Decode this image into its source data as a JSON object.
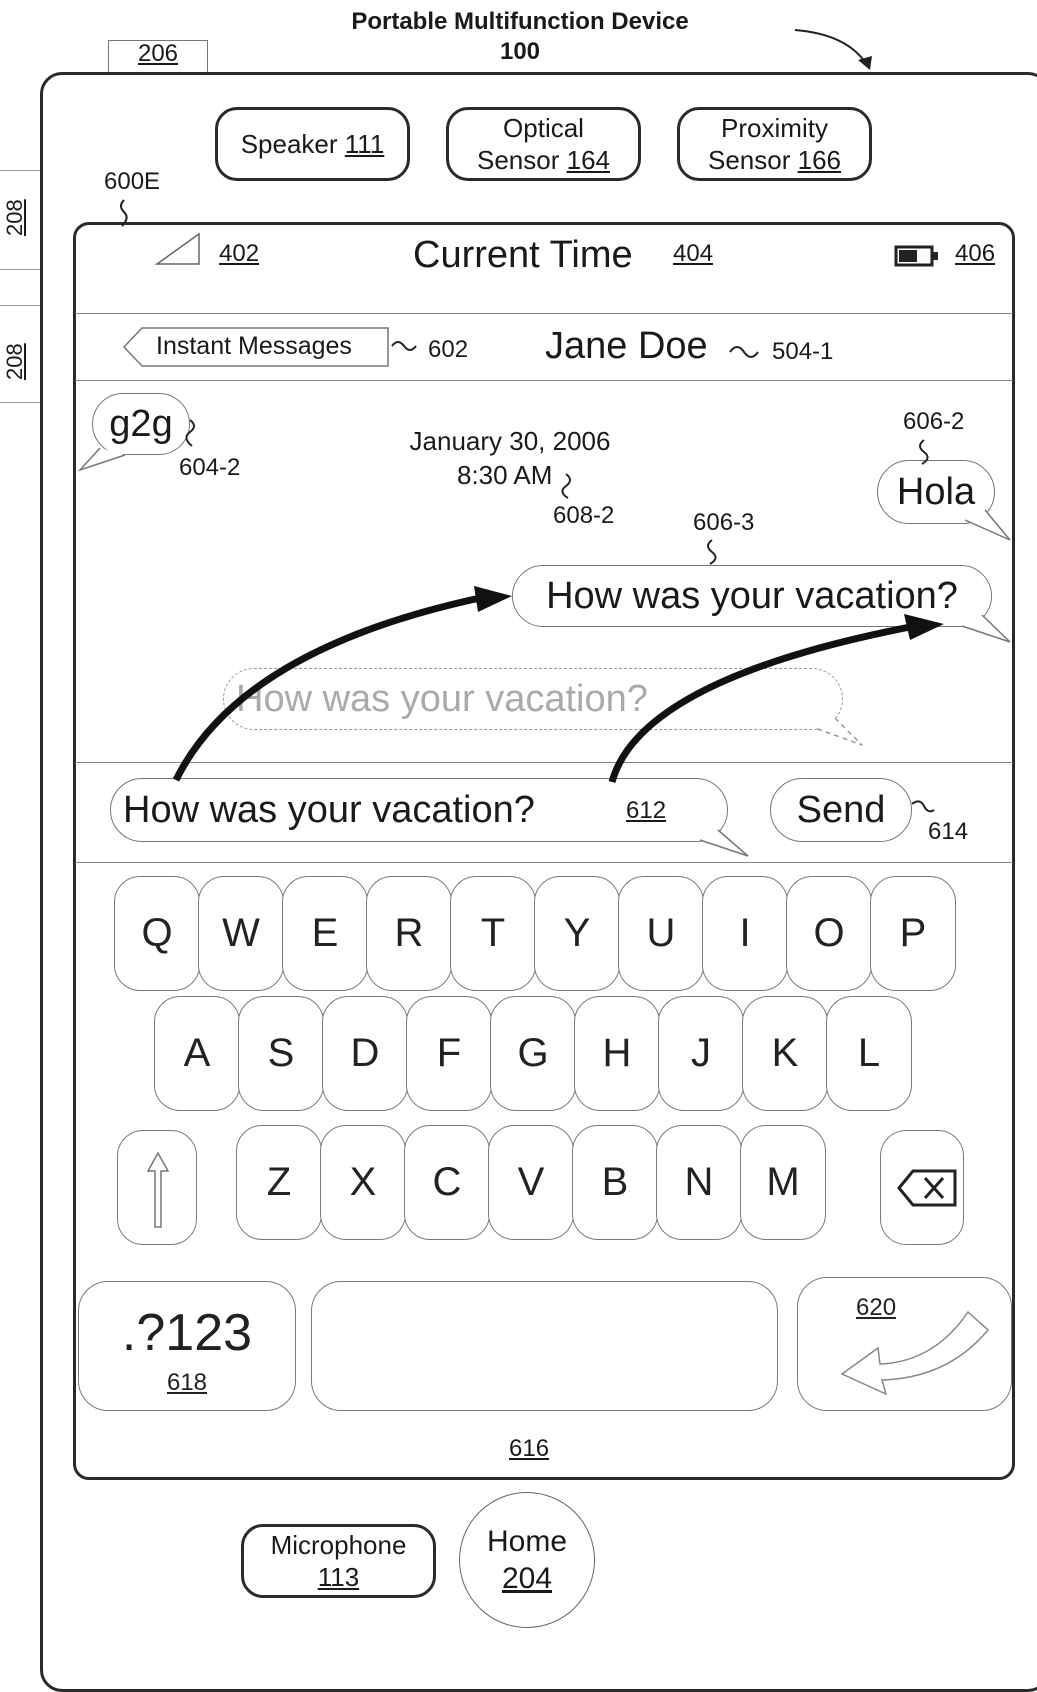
{
  "header": {
    "title": "Portable Multifunction Device",
    "number": "100",
    "tab_ref": "206",
    "side_ref_1": "208",
    "side_ref_2": "208",
    "screen_ref": "600E"
  },
  "hardware": {
    "speaker": {
      "label": "Speaker",
      "ref": "111"
    },
    "optical": {
      "label1": "Optical",
      "label2": "Sensor",
      "ref": "164"
    },
    "proximity": {
      "label1": "Proximity",
      "label2": "Sensor",
      "ref": "166"
    },
    "microphone": {
      "label": "Microphone",
      "ref": "113"
    },
    "home": {
      "label": "Home",
      "ref": "204"
    }
  },
  "status_bar": {
    "signal_ref": "402",
    "time_label": "Current Time",
    "time_ref": "404",
    "battery_ref": "406"
  },
  "nav_bar": {
    "back_label": "Instant Messages",
    "back_ref": "602",
    "contact": "Jane Doe",
    "contact_ref": "504-1"
  },
  "conversation": {
    "msg_g2g": "g2g",
    "msg_g2g_ref": "604-2",
    "timestamp_date": "January 30, 2006",
    "timestamp_time": "8:30 AM",
    "timestamp_ref": "608-2",
    "msg_hola": "Hola",
    "msg_hola_ref": "606-2",
    "msg_sent": "How was your vacation?",
    "msg_sent_ref": "606-3",
    "msg_animating": "How was your vacation?"
  },
  "input": {
    "value": "How was your vacation?",
    "ref": "612",
    "send_label": "Send",
    "send_ref": "614"
  },
  "keyboard": {
    "row1": [
      "Q",
      "W",
      "E",
      "R",
      "T",
      "Y",
      "U",
      "I",
      "O",
      "P"
    ],
    "row2": [
      "A",
      "S",
      "D",
      "F",
      "G",
      "H",
      "J",
      "K",
      "L"
    ],
    "row3": [
      "Z",
      "X",
      "C",
      "V",
      "B",
      "N",
      "M"
    ],
    "numbers_label": ".?123",
    "numbers_ref": "618",
    "return_ref": "620",
    "keyboard_ref": "616",
    "shift_icon": "shift-arrow-icon",
    "backspace_icon": "backspace-icon"
  }
}
